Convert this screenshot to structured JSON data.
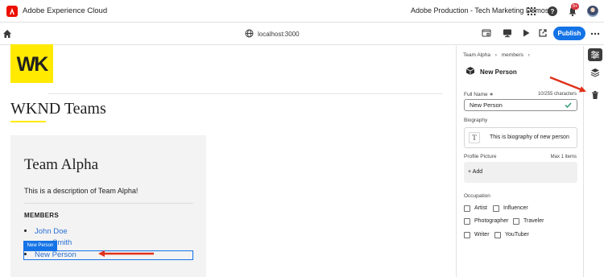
{
  "shell": {
    "app_title": "Adobe Experience Cloud",
    "org_name": "Adobe Production - Tech Marketing Demos",
    "notification_count": "9+"
  },
  "toolbar": {
    "url": "localhost:3000",
    "publish_label": "Publish"
  },
  "canvas": {
    "logo_text": "WK",
    "page_title": "WKND Teams",
    "team_name": "Team Alpha",
    "team_description": "This is a description of Team Alpha!",
    "members_heading": "MEMBERS",
    "members": [
      "John Doe",
      "Smith",
      "New Person"
    ],
    "selected_tag": "New Person"
  },
  "panel": {
    "breadcrumb": [
      "Team Alpha",
      "members"
    ],
    "component_name": "New Person",
    "full_name_label": "Full Name ∗",
    "full_name_count": "10/255 characters",
    "full_name_value": "New Person",
    "biography_label": "Biography",
    "biography_text": "This is biography of new person",
    "profile_picture_label": "Profile Picture",
    "profile_picture_max": "Max 1 items",
    "add_label": "+ Add",
    "occupation_label": "Occupation",
    "occupations": [
      "Artist",
      "Influencer",
      "Photographer",
      "Traveler",
      "Writer",
      "YouTuber"
    ]
  },
  "colors": {
    "accent": "#1473e6",
    "adobe_red": "#eb1000",
    "wknd_yellow": "#ffea00",
    "arrow_red": "#e0311b"
  },
  "icons": [
    "adobe-logo-icon",
    "apps-grid-icon",
    "help-icon",
    "bell-icon",
    "home-icon",
    "globe-icon",
    "page-settings-icon",
    "desktop-icon",
    "play-icon",
    "open-external-icon",
    "more-icon",
    "cube-icon",
    "check-icon",
    "properties-icon",
    "layers-icon",
    "trash-icon"
  ]
}
